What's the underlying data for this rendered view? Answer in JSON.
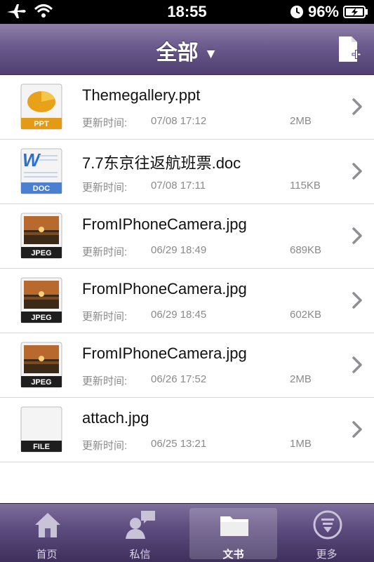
{
  "status_bar": {
    "time": "18:55",
    "battery": "96%"
  },
  "navbar": {
    "title": "全部",
    "caret": "▼"
  },
  "files": [
    {
      "name": "Themegallery.ppt",
      "label": "更新时间:",
      "date": "07/08 17:12",
      "size": "2MB",
      "badge": "PPT",
      "kind": "ppt"
    },
    {
      "name": "7.7东京往返航班票.doc",
      "label": "更新时间:",
      "date": "07/08 17:11",
      "size": "115KB",
      "badge": "DOC",
      "kind": "doc"
    },
    {
      "name": "FromIPhoneCamera.jpg",
      "label": "更新时间:",
      "date": "06/29 18:49",
      "size": "689KB",
      "badge": "JPEG",
      "kind": "jpeg"
    },
    {
      "name": "FromIPhoneCamera.jpg",
      "label": "更新时间:",
      "date": "06/29 18:45",
      "size": "602KB",
      "badge": "JPEG",
      "kind": "jpeg"
    },
    {
      "name": "FromIPhoneCamera.jpg",
      "label": "更新时间:",
      "date": "06/26 17:52",
      "size": "2MB",
      "badge": "JPEG",
      "kind": "jpeg"
    },
    {
      "name": "attach.jpg",
      "label": "更新时间:",
      "date": "06/25 13:21",
      "size": "1MB",
      "badge": "FILE",
      "kind": "file"
    }
  ],
  "tabs": [
    {
      "label": "首页",
      "icon": "home-icon"
    },
    {
      "label": "私信",
      "icon": "message-icon"
    },
    {
      "label": "文书",
      "icon": "folder-icon",
      "active": true
    },
    {
      "label": "更多",
      "icon": "more-icon"
    }
  ]
}
